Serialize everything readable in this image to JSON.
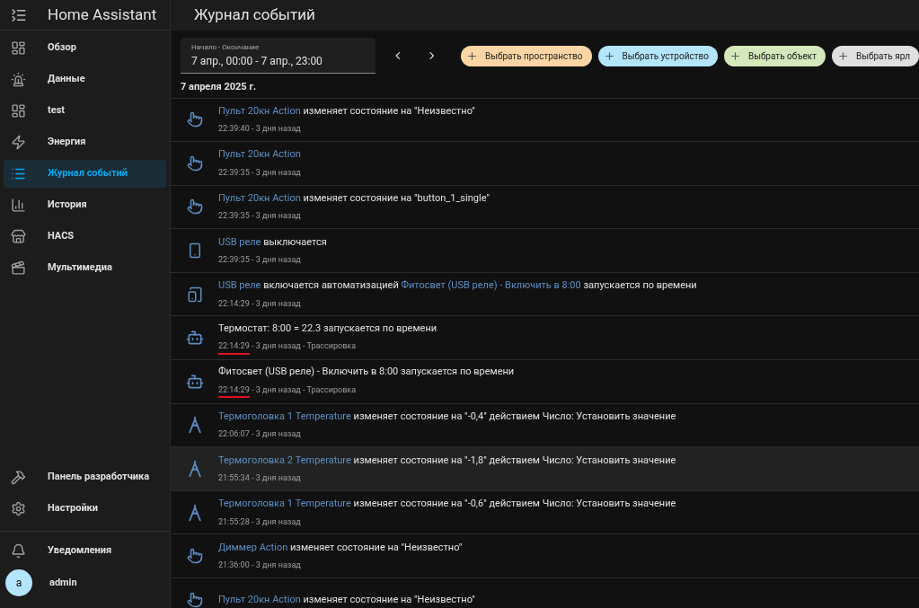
{
  "sidebar": {
    "title": "Home Assistant",
    "items": [
      {
        "label": "Обзор",
        "selected": false
      },
      {
        "label": "Данные",
        "selected": false
      },
      {
        "label": "test",
        "selected": false
      },
      {
        "label": "Энергия",
        "selected": false
      },
      {
        "label": "Журнал событий",
        "selected": true
      },
      {
        "label": "История",
        "selected": false
      },
      {
        "label": "HACS",
        "selected": false
      },
      {
        "label": "Мультимедиа",
        "selected": false
      }
    ],
    "bottom_items": [
      {
        "label": "Панель разработчика"
      },
      {
        "label": "Настройки"
      }
    ],
    "notifications": "Уведомления",
    "user": {
      "initial": "a",
      "name": "admin"
    }
  },
  "page_title": "Журнал событий",
  "date_range": {
    "label": "Начало - Окончание",
    "value": "7 апр., 00:00 - 7 апр., 23:00"
  },
  "filters": [
    {
      "label": "Выбрать пространство",
      "color": "#fed6a4"
    },
    {
      "label": "Выбрать устройство",
      "color": "#b3e5fc"
    },
    {
      "label": "Выбрать объект",
      "color": "#d4e8bc"
    },
    {
      "label": "Выбрать ярл",
      "color": "#e0e0e0"
    }
  ],
  "date_heading": "7 апреля 2025 г.",
  "events": [
    {
      "kind": "button",
      "highlighted": false,
      "parts": [
        {
          "text": "Пульт 20кн Action",
          "link": true
        },
        {
          "text": " изменяет состояние на \"Неизвестно\"",
          "link": false
        }
      ],
      "time": "22:39:40",
      "ago": " - 3 дня назад",
      "underlined": false
    },
    {
      "kind": "button",
      "highlighted": false,
      "parts": [
        {
          "text": "Пульт 20кн Action",
          "link": true
        }
      ],
      "time": "22:39:35",
      "ago": " - 3 дня назад",
      "underlined": false
    },
    {
      "kind": "button",
      "highlighted": false,
      "parts": [
        {
          "text": "Пульт 20кн Action",
          "link": true
        },
        {
          "text": " изменяет состояние на \"button_1_single\"",
          "link": false
        }
      ],
      "time": "22:39:35",
      "ago": " - 3 дня назад",
      "underlined": false
    },
    {
      "kind": "phone",
      "highlighted": false,
      "parts": [
        {
          "text": "USB реле",
          "link": true
        },
        {
          "text": " выключается",
          "link": false
        }
      ],
      "time": "22:39:35",
      "ago": " - 3 дня назад",
      "underlined": false
    },
    {
      "kind": "phone_on",
      "highlighted": false,
      "parts": [
        {
          "text": "USB реле",
          "link": true
        },
        {
          "text": " включается автоматизацией ",
          "link": false
        },
        {
          "text": "Фитосвет (USB реле) - Включить в 8:00",
          "link": true
        },
        {
          "text": " запускается по времени",
          "link": false
        }
      ],
      "time": "22:14:29",
      "ago": " - 3 дня назад",
      "underlined": false
    },
    {
      "kind": "robot",
      "highlighted": false,
      "parts": [
        {
          "text": "Термостат: 8:00 = 22.3 запускается по времени",
          "link": false
        }
      ],
      "time": "22:14:29",
      "ago": " - 3 дня назад",
      "trace": " - Трассировка",
      "underlined": true
    },
    {
      "kind": "robot",
      "highlighted": false,
      "parts": [
        {
          "text": "Фитосвет (USB реле) - Включить в 8:00 запускается по времени",
          "link": false
        }
      ],
      "time": "22:14:29",
      "ago": " - 3 дня назад",
      "trace": " - Трассировка",
      "underlined": true
    },
    {
      "kind": "angle",
      "highlighted": false,
      "parts": [
        {
          "text": "Термоголовка 1 Temperature",
          "link": true
        },
        {
          "text": " изменяет состояние на \"-0,4\" действием Число: Установить значение",
          "link": false
        }
      ],
      "time": "22:06:07",
      "ago": " - 3 дня назад",
      "underlined": false
    },
    {
      "kind": "angle",
      "highlighted": true,
      "parts": [
        {
          "text": "Термоголовка 2 Temperature",
          "link": true
        },
        {
          "text": " изменяет состояние на \"-1,8\" действием Число: Установить значение",
          "link": false
        }
      ],
      "time": "21:55:34",
      "ago": " - 3 дня назад",
      "underlined": false
    },
    {
      "kind": "angle",
      "highlighted": false,
      "parts": [
        {
          "text": "Термоголовка 1 Temperature",
          "link": true
        },
        {
          "text": " изменяет состояние на \"-0,6\" действием Число: Установить значение",
          "link": false
        }
      ],
      "time": "21:55:28",
      "ago": " - 3 дня назад",
      "underlined": false
    },
    {
      "kind": "button",
      "highlighted": false,
      "parts": [
        {
          "text": "Диммер Action",
          "link": true
        },
        {
          "text": " изменяет состояние на \"Неизвестно\"",
          "link": false
        }
      ],
      "time": "21:36:00",
      "ago": " - 3 дня назад",
      "underlined": false
    },
    {
      "kind": "button",
      "highlighted": false,
      "parts": [
        {
          "text": "Пульт 20кн Action",
          "link": true
        },
        {
          "text": " изменяет состояние на \"Неизвестно\"",
          "link": false
        }
      ]
    }
  ]
}
